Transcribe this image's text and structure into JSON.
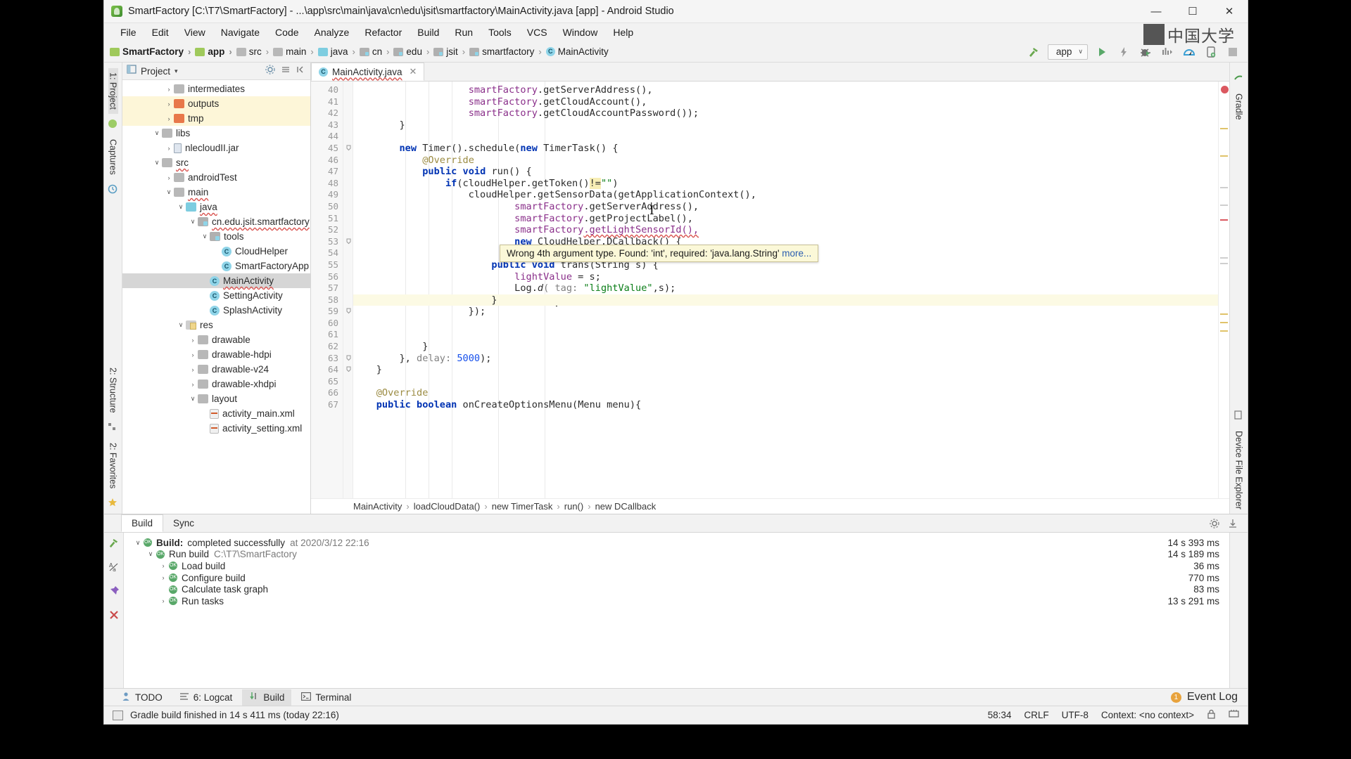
{
  "window": {
    "title": "SmartFactory [C:\\T7\\SmartFactory] - ...\\app\\src\\main\\java\\cn\\edu\\jsit\\smartfactory\\MainActivity.java [app] - Android Studio",
    "app_icon": "android-studio-icon",
    "minimize": "—",
    "maximize": "☐",
    "close": "✕"
  },
  "menubar": [
    {
      "label": "File"
    },
    {
      "label": "Edit"
    },
    {
      "label": "View"
    },
    {
      "label": "Navigate"
    },
    {
      "label": "Code"
    },
    {
      "label": "Analyze"
    },
    {
      "label": "Refactor"
    },
    {
      "label": "Build"
    },
    {
      "label": "Run"
    },
    {
      "label": "Tools"
    },
    {
      "label": "VCS"
    },
    {
      "label": "Window"
    },
    {
      "label": "Help"
    }
  ],
  "breadcrumb": [
    {
      "label": "SmartFactory",
      "icon": "folder-module-icon"
    },
    {
      "label": "app",
      "icon": "folder-module-icon"
    },
    {
      "label": "src",
      "icon": "folder-icon"
    },
    {
      "label": "main",
      "icon": "folder-icon"
    },
    {
      "label": "java",
      "icon": "folder-source-icon"
    },
    {
      "label": "cn",
      "icon": "package-icon"
    },
    {
      "label": "edu",
      "icon": "package-icon"
    },
    {
      "label": "jsit",
      "icon": "package-icon"
    },
    {
      "label": "smartfactory",
      "icon": "package-icon"
    },
    {
      "label": "MainActivity",
      "icon": "class-icon"
    }
  ],
  "toolbar": {
    "build_icon": "hammer-icon",
    "run_config": "app",
    "run_config_icon": "module-icon",
    "dropdown_caret": "∨",
    "run_icon": "run-icon",
    "apply_changes_icon": "lightning-icon",
    "debug_icon": "debug-icon",
    "run_coverage_icon": "profiler-steps-icon",
    "profiler_icon": "profiler-icon",
    "avd_icon": "device-manager-icon",
    "stop_icon": "stop-icon"
  },
  "watermark": {
    "text": "中国大学"
  },
  "left_strip": {
    "tabs": [
      {
        "label": "1: Project",
        "selected": true
      },
      {
        "label": "Captures",
        "selected": false
      },
      {
        "label": "2: Structure",
        "selected": false
      },
      {
        "label": "2: Favorites",
        "selected": false
      }
    ]
  },
  "right_strip": {
    "tabs": [
      {
        "label": "Gradle"
      },
      {
        "label": "Device File Explorer"
      }
    ]
  },
  "project_panel": {
    "title": "Project",
    "dropdown_caret": "▾",
    "settings_icon": "gear-icon",
    "collapse_icon": "collapse-all-icon",
    "hide_icon": "hide-icon",
    "tree": [
      {
        "label": "intermediates",
        "depth": 3,
        "arrow": "›",
        "icon": "folder-grey",
        "state": "normal"
      },
      {
        "label": "outputs",
        "depth": 3,
        "arrow": "›",
        "icon": "folder-orange",
        "state": "highlight"
      },
      {
        "label": "tmp",
        "depth": 3,
        "arrow": "›",
        "icon": "folder-orange",
        "state": "highlight"
      },
      {
        "label": "libs",
        "depth": 2,
        "arrow": "∨",
        "icon": "folder-grey",
        "state": "normal"
      },
      {
        "label": "nlecloudII.jar",
        "depth": 3,
        "arrow": "›",
        "icon": "jar",
        "state": "normal"
      },
      {
        "label": "src",
        "depth": 2,
        "arrow": "∨",
        "icon": "folder-grey",
        "state": "normal"
      },
      {
        "label": "androidTest",
        "depth": 3,
        "arrow": "›",
        "icon": "folder-grey",
        "state": "normal"
      },
      {
        "label": "main",
        "depth": 3,
        "arrow": "∨",
        "icon": "folder-grey",
        "state": "normal"
      },
      {
        "label": "java",
        "depth": 4,
        "arrow": "∨",
        "icon": "folder-cyan",
        "state": "normal"
      },
      {
        "label": "cn.edu.jsit.smartfactory",
        "depth": 5,
        "arrow": "∨",
        "icon": "package",
        "state": "normal"
      },
      {
        "label": "tools",
        "depth": 6,
        "arrow": "∨",
        "icon": "package",
        "state": "normal"
      },
      {
        "label": "CloudHelper",
        "depth": 7,
        "arrow": "",
        "icon": "class",
        "state": "normal"
      },
      {
        "label": "SmartFactoryApp",
        "depth": 7,
        "arrow": "",
        "icon": "class",
        "state": "normal"
      },
      {
        "label": "MainActivity",
        "depth": 6,
        "arrow": "",
        "icon": "class",
        "state": "selected"
      },
      {
        "label": "SettingActivity",
        "depth": 6,
        "arrow": "",
        "icon": "class",
        "state": "normal"
      },
      {
        "label": "SplashActivity",
        "depth": 6,
        "arrow": "",
        "icon": "class",
        "state": "normal"
      },
      {
        "label": "res",
        "depth": 4,
        "arrow": "∨",
        "icon": "folder-res",
        "state": "normal"
      },
      {
        "label": "drawable",
        "depth": 5,
        "arrow": "›",
        "icon": "folder-grey",
        "state": "normal"
      },
      {
        "label": "drawable-hdpi",
        "depth": 5,
        "arrow": "›",
        "icon": "folder-grey",
        "state": "normal"
      },
      {
        "label": "drawable-v24",
        "depth": 5,
        "arrow": "›",
        "icon": "folder-grey",
        "state": "normal"
      },
      {
        "label": "drawable-xhdpi",
        "depth": 5,
        "arrow": "›",
        "icon": "folder-grey",
        "state": "normal"
      },
      {
        "label": "layout",
        "depth": 5,
        "arrow": "∨",
        "icon": "folder-grey",
        "state": "normal"
      },
      {
        "label": "activity_main.xml",
        "depth": 6,
        "arrow": "",
        "icon": "xml",
        "state": "normal"
      },
      {
        "label": "activity_setting.xml",
        "depth": 6,
        "arrow": "",
        "icon": "xml",
        "state": "normal"
      }
    ]
  },
  "editor": {
    "tab": {
      "label": "MainActivity.java",
      "icon": "class-icon",
      "close": "✕"
    },
    "first_line_number": 40,
    "current_line": 58,
    "lines": [
      {
        "n": 40,
        "marker": "",
        "tokens": [
          {
            "t": "                    ",
            "c": "plain"
          },
          {
            "t": "smartFactory",
            "c": "fld"
          },
          {
            "t": ".getServerAddress(),",
            "c": "plain"
          }
        ]
      },
      {
        "n": 41,
        "marker": "",
        "tokens": [
          {
            "t": "                    ",
            "c": "plain"
          },
          {
            "t": "smartFactory",
            "c": "fld"
          },
          {
            "t": ".getCloudAccount(),",
            "c": "plain"
          }
        ]
      },
      {
        "n": 42,
        "marker": "",
        "tokens": [
          {
            "t": "                    ",
            "c": "plain"
          },
          {
            "t": "smartFactory",
            "c": "fld"
          },
          {
            "t": ".getCloudAccountPassword());",
            "c": "plain"
          }
        ]
      },
      {
        "n": 43,
        "marker": "",
        "tokens": [
          {
            "t": "        }",
            "c": "plain"
          }
        ]
      },
      {
        "n": 44,
        "marker": "",
        "tokens": [
          {
            "t": "",
            "c": "plain"
          }
        ]
      },
      {
        "n": 45,
        "marker": "",
        "tokens": [
          {
            "t": "        ",
            "c": "plain"
          },
          {
            "t": "new",
            "c": "kw"
          },
          {
            "t": " Timer().schedule(",
            "c": "plain"
          },
          {
            "t": "new",
            "c": "kw"
          },
          {
            "t": " TimerTask() {",
            "c": "plain"
          }
        ]
      },
      {
        "n": 46,
        "marker": "",
        "tokens": [
          {
            "t": "            ",
            "c": "plain"
          },
          {
            "t": "@Override",
            "c": "ann"
          }
        ]
      },
      {
        "n": 47,
        "marker": "override",
        "tokens": [
          {
            "t": "            ",
            "c": "plain"
          },
          {
            "t": "public",
            "c": "kw"
          },
          {
            "t": " ",
            "c": "plain"
          },
          {
            "t": "void",
            "c": "kw"
          },
          {
            "t": " run() {",
            "c": "plain"
          }
        ]
      },
      {
        "n": 48,
        "marker": "",
        "tokens": [
          {
            "t": "                ",
            "c": "plain"
          },
          {
            "t": "if",
            "c": "kw"
          },
          {
            "t": "(cloudHelper.getToken()",
            "c": "plain"
          },
          {
            "t": "!=",
            "c": "hlt"
          },
          {
            "t": "\"\"",
            "c": "str"
          },
          {
            "t": ")",
            "c": "plain"
          }
        ]
      },
      {
        "n": 49,
        "marker": "",
        "tokens": [
          {
            "t": "                    cloudHelper.getSensorData(getApplicationContext(),",
            "c": "plain"
          }
        ]
      },
      {
        "n": 50,
        "marker": "",
        "tokens": [
          {
            "t": "                            ",
            "c": "plain"
          },
          {
            "t": "smartFactory",
            "c": "fld"
          },
          {
            "t": ".getServerAddress(),",
            "c": "plain"
          }
        ]
      },
      {
        "n": 51,
        "marker": "",
        "tokens": [
          {
            "t": "                            ",
            "c": "plain"
          },
          {
            "t": "smartFactory",
            "c": "fld"
          },
          {
            "t": ".getProjectLabel(),",
            "c": "plain"
          }
        ]
      },
      {
        "n": 52,
        "marker": "",
        "tokens": [
          {
            "t": "                            ",
            "c": "plain"
          },
          {
            "t": "smartFactory",
            "c": "fld"
          },
          {
            "t": ".getLightSensorId(),",
            "c": "wavy"
          }
        ]
      },
      {
        "n": 53,
        "marker": "",
        "tokens": [
          {
            "t": "                            ",
            "c": "plain"
          },
          {
            "t": "new",
            "c": "kw"
          },
          {
            "t": " CloudHelper.DCallback() {",
            "c": "plain"
          }
        ]
      },
      {
        "n": 54,
        "marker": "",
        "tokens": [
          {
            "t": "",
            "c": "plain"
          }
        ]
      },
      {
        "n": 55,
        "marker": "override",
        "tokens": [
          {
            "t": "                        ",
            "c": "plain"
          },
          {
            "t": "public",
            "c": "kw"
          },
          {
            "t": " ",
            "c": "plain"
          },
          {
            "t": "void",
            "c": "kw"
          },
          {
            "t": " trans(String s) {",
            "c": "plain"
          }
        ]
      },
      {
        "n": 56,
        "marker": "",
        "tokens": [
          {
            "t": "                            ",
            "c": "plain"
          },
          {
            "t": "lightValue",
            "c": "fld"
          },
          {
            "t": " = s;",
            "c": "plain"
          }
        ]
      },
      {
        "n": 57,
        "marker": "",
        "tokens": [
          {
            "t": "                            Log.",
            "c": "plain"
          },
          {
            "t": "d",
            "c": "mth-italic"
          },
          {
            "t": "( tag: ",
            "c": "param"
          },
          {
            "t": "\"lightValue\"",
            "c": "str"
          },
          {
            "t": ",s);",
            "c": "plain"
          }
        ]
      },
      {
        "n": 58,
        "marker": "",
        "tokens": [
          {
            "t": "                        }",
            "c": "plain"
          }
        ]
      },
      {
        "n": 59,
        "marker": "",
        "tokens": [
          {
            "t": "                    });",
            "c": "plain"
          }
        ]
      },
      {
        "n": 60,
        "marker": "",
        "tokens": [
          {
            "t": "",
            "c": "plain"
          }
        ]
      },
      {
        "n": 61,
        "marker": "",
        "tokens": [
          {
            "t": "",
            "c": "plain"
          }
        ]
      },
      {
        "n": 62,
        "marker": "",
        "tokens": [
          {
            "t": "            }",
            "c": "plain"
          }
        ]
      },
      {
        "n": 63,
        "marker": "",
        "tokens": [
          {
            "t": "        }, ",
            "c": "plain"
          },
          {
            "t": "delay:",
            "c": "param"
          },
          {
            "t": " ",
            "c": "plain"
          },
          {
            "t": "5000",
            "c": "num"
          },
          {
            "t": ");",
            "c": "plain"
          }
        ]
      },
      {
        "n": 64,
        "marker": "",
        "tokens": [
          {
            "t": "    }",
            "c": "plain"
          }
        ]
      },
      {
        "n": 65,
        "marker": "",
        "tokens": [
          {
            "t": "",
            "c": "plain"
          }
        ]
      },
      {
        "n": 66,
        "marker": "",
        "tokens": [
          {
            "t": "    ",
            "c": "plain"
          },
          {
            "t": "@Override",
            "c": "ann"
          }
        ]
      },
      {
        "n": 67,
        "marker": "override",
        "tokens": [
          {
            "t": "    ",
            "c": "plain"
          },
          {
            "t": "public",
            "c": "kw"
          },
          {
            "t": " ",
            "c": "plain"
          },
          {
            "t": "boolean",
            "c": "kw"
          },
          {
            "t": " onCreateOptionsMenu(Menu menu){",
            "c": "plain"
          }
        ]
      }
    ],
    "tooltip": {
      "message": "Wrong 4th argument type. Found: 'int', required: 'java.lang.String'",
      "link": "more..."
    },
    "crumb": [
      {
        "label": "MainActivity"
      },
      {
        "label": "loadCloudData()"
      },
      {
        "label": "new TimerTask"
      },
      {
        "label": "run()"
      },
      {
        "label": "new DCallback"
      }
    ],
    "crumb_sep": "›"
  },
  "build_panel": {
    "tabs": [
      {
        "label": "Build",
        "selected": true
      },
      {
        "label": "Sync",
        "selected": false
      }
    ],
    "settings_icon": "gear-icon",
    "export_icon": "download-icon",
    "rows": [
      {
        "label": "Build:",
        "label2": "completed successfully",
        "sub": "at 2020/3/12 22:16",
        "time": "14 s 393 ms",
        "depth": 0,
        "arrow": "∨",
        "bold": true
      },
      {
        "label": "Run build",
        "label2": "",
        "sub": "C:\\T7\\SmartFactory",
        "time": "14 s 189 ms",
        "depth": 1,
        "arrow": "∨",
        "bold": false
      },
      {
        "label": "Load build",
        "label2": "",
        "sub": "",
        "time": "36 ms",
        "depth": 2,
        "arrow": "›",
        "bold": false
      },
      {
        "label": "Configure build",
        "label2": "",
        "sub": "",
        "time": "770 ms",
        "depth": 2,
        "arrow": "›",
        "bold": false
      },
      {
        "label": "Calculate task graph",
        "label2": "",
        "sub": "",
        "time": "83 ms",
        "depth": 2,
        "arrow": "",
        "bold": false
      },
      {
        "label": "Run tasks",
        "label2": "",
        "sub": "",
        "time": "13 s 291 ms",
        "depth": 2,
        "arrow": "›",
        "bold": false
      }
    ],
    "side_icons": [
      "hammer-icon",
      "toggle-case-icon",
      "pin-icon",
      "close-icon"
    ]
  },
  "bottom_toolbar": {
    "items": [
      {
        "label": "TODO",
        "icon": "todo-icon",
        "selected": false
      },
      {
        "label": "6: Logcat",
        "icon": "logcat-icon",
        "selected": false
      },
      {
        "label": "Build",
        "icon": "build-icon",
        "selected": true
      },
      {
        "label": "Terminal",
        "icon": "terminal-icon",
        "selected": false
      }
    ],
    "event_log": {
      "label": "Event Log",
      "badge": "1"
    }
  },
  "statusbar": {
    "message": "Gradle build finished in 14 s 411 ms (today 22:16)",
    "caret_position": "58:34",
    "line_separator": "CRLF",
    "encoding": "UTF-8",
    "context": "Context: <no context>",
    "lock_icon": "lock-icon",
    "memory_icon": "memory-icon"
  },
  "colors": {
    "accent_green": "#59a869",
    "error_red": "#db5860",
    "keyword_blue": "#0033b3",
    "string_green": "#0a7d17",
    "field_purple": "#8a2f8a",
    "tooltip_bg": "#fbf8d8",
    "highlight_yellow": "#fdf6d8"
  }
}
